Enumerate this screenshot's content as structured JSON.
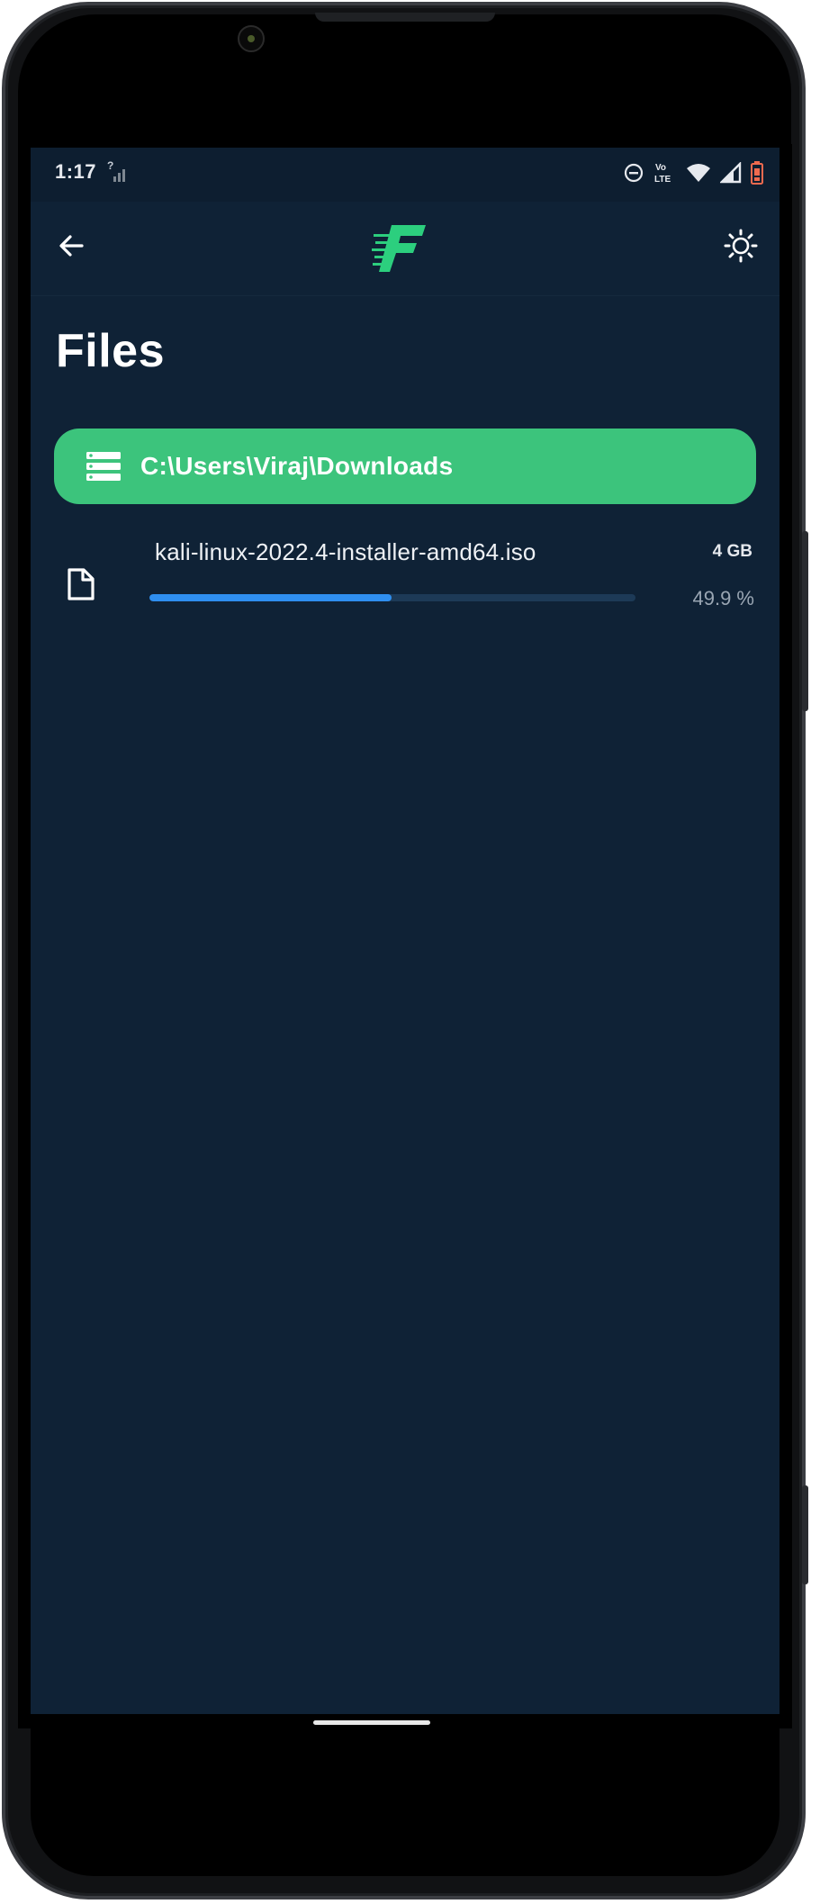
{
  "status_bar": {
    "time": "1:17",
    "signal_hint": "?",
    "volte_label": "VoLTE",
    "icons": [
      "do-not-disturb-icon",
      "volte-icon",
      "wifi-icon",
      "cell-signal-icon",
      "battery-low-icon"
    ]
  },
  "app_bar": {
    "back_icon": "arrow-back-icon",
    "logo_icon": "app-logo-f-icon",
    "theme_icon": "brightness-icon"
  },
  "page": {
    "title": "Files"
  },
  "path_bar": {
    "icon": "storage-list-icon",
    "path": "C:\\Users\\Viraj\\Downloads"
  },
  "files": [
    {
      "name": "kali-linux-2022.4-installer-amd64.iso",
      "size": "4 GB",
      "progress_label": "49.9 %",
      "progress_fraction": 0.499,
      "icon": "file-icon"
    }
  ],
  "colors": {
    "background": "#0f2236",
    "accent_green": "#3cc47c",
    "progress_blue": "#2f8ff0"
  }
}
